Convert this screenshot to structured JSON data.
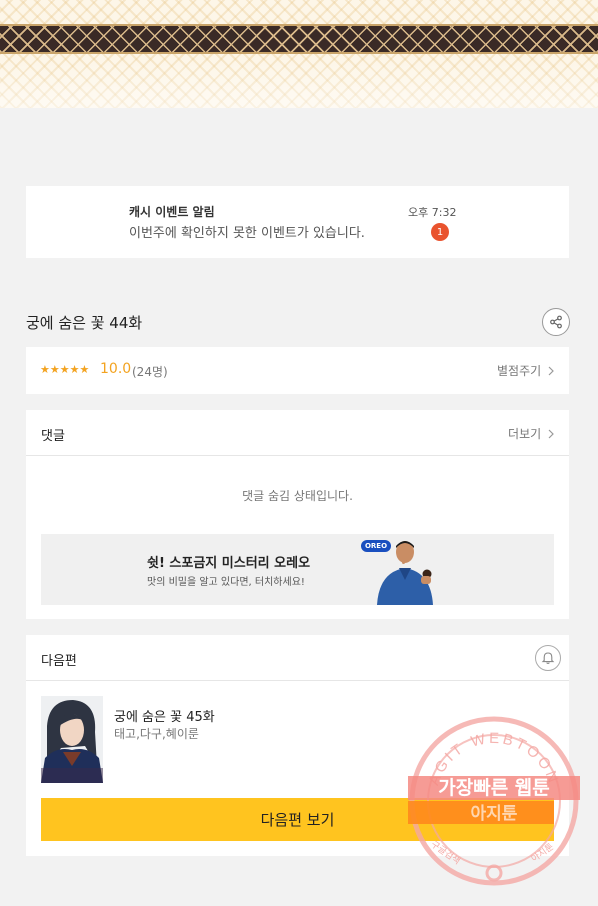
{
  "notification": {
    "title": "캐시 이벤트 알림",
    "message": "이번주에 확인하지 못한 이벤트가 있습니다.",
    "time": "오후 7:32",
    "badge_count": "1"
  },
  "episode": {
    "title": "궁에 숨은 꽃 44화"
  },
  "rating": {
    "stars": "★★★★★",
    "score": "10.0",
    "votes": "(24명)",
    "rate_link": "별점주기"
  },
  "comments": {
    "title": "댓글",
    "more": "더보기",
    "hidden_message": "댓글 숨김 상태입니다."
  },
  "ad": {
    "headline": "쉿! 스포금지 미스터리 오레오",
    "subline": "맛의 비밀을 알고 있다면, 터치하세요!",
    "logo": "OREO"
  },
  "next_episode": {
    "section_title": "다음편",
    "title": "궁에 숨은 꽃 45화",
    "authors": "태고,다구,혜이룬",
    "button_label": "다음편 보기"
  },
  "watermark": {
    "arc_text": "AGIT WEBTOON",
    "line1": "가장빠른 웹툰",
    "line2": "아지툰",
    "bottom_left": "구글검색",
    "bottom_right": "아지툰"
  },
  "colors": {
    "accent_yellow": "#ffc41f",
    "star_orange": "#f3a320",
    "badge_red": "#e9532e"
  }
}
